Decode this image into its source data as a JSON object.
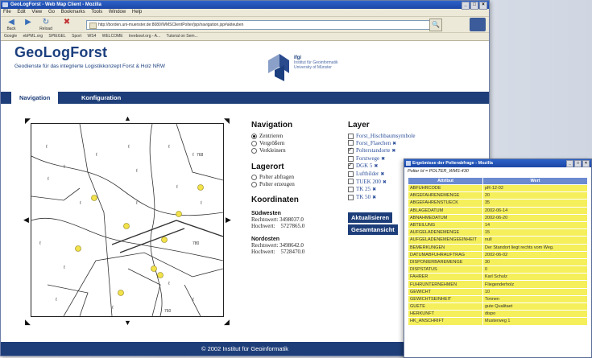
{
  "browser": {
    "title": "GeoLogForst - Web Map Client - Mozilla",
    "menu": [
      "File",
      "Edit",
      "View",
      "Go",
      "Bookmarks",
      "Tools",
      "Window",
      "Help"
    ],
    "back_label": "Back",
    "forward_label": "",
    "reload_label": "Reload",
    "url": "http://borden.uni-muenster.de:8080/WMSClientPolter/jsp/navigation.jsp#akteuben",
    "bookmarks": [
      "Google",
      "ebPML.org",
      "SPIEGEL",
      "Sport",
      "WS4",
      "WELCOME",
      "treebowl.org - A...",
      "Tutorial on Sem..."
    ]
  },
  "header": {
    "title": "GeoLogForst",
    "subtitle": "Geodienste für das integrierte Logistikkonzept Forst & Holz NRW",
    "inst_short": "ifgi",
    "inst_line1": "Institut für Geoinformatik",
    "inst_line2": "University of Münster"
  },
  "tabs": [
    {
      "label": "Navigation",
      "active": true
    },
    {
      "label": "Konfiguration",
      "active": false
    }
  ],
  "navigation": {
    "heading": "Navigation",
    "options": [
      {
        "label": "Zentrieren",
        "selected": true
      },
      {
        "label": "Vergrößern",
        "selected": false
      },
      {
        "label": "Verkleinern",
        "selected": false
      }
    ]
  },
  "lagerort": {
    "heading": "Lagerort",
    "options": [
      {
        "label": "Polter abfragen",
        "selected": false
      },
      {
        "label": "Polter erzeugen",
        "selected": false
      }
    ]
  },
  "koordinaten": {
    "heading": "Koordinaten",
    "sw_label": "Südwesten",
    "sw_rechts": "Rechtswert: 3498037.0",
    "sw_hoch": "Hochwert:    5727865.0",
    "ne_label": "Nordosten",
    "ne_rechts": "Rechtswert: 3498642.0",
    "ne_hoch": "Hochwert:    5728470.0"
  },
  "layer": {
    "heading": "Layer",
    "items": [
      {
        "label": "Forst_Hischbaumsymbole",
        "checked": false,
        "x": false
      },
      {
        "label": "Forst_Flaechen",
        "checked": false,
        "x": true
      },
      {
        "label": "Polterstandorte",
        "checked": true,
        "x": true
      },
      {
        "label": "Forstwege",
        "checked": false,
        "x": true
      },
      {
        "label": "DGK 5",
        "checked": true,
        "x": true
      },
      {
        "label": "Luftbilder",
        "checked": false,
        "x": true
      },
      {
        "label": "TUEK 200",
        "checked": false,
        "x": true
      },
      {
        "label": "TK 25",
        "checked": false,
        "x": true
      },
      {
        "label": "TK 50",
        "checked": false,
        "x": true
      }
    ],
    "refresh_label": "Aktualisieren",
    "overview_label": "Gesamtansicht"
  },
  "map": {
    "labels": [
      "768",
      "780",
      "760"
    ],
    "colors": {
      "polter": "#f2e24a",
      "line": "#333333"
    }
  },
  "footer": "© 2002 Institut für Geoinformatik",
  "popup": {
    "title": "Ergebnisse der Polterabfrage - Mozilla",
    "polter_id": "Polter Id = POLTER_WMS-430",
    "col_attr": "Attribut",
    "col_val": "Wert",
    "rows": [
      [
        "ABFUHRCODE",
        "pR-12-02"
      ],
      [
        "ABGEFAHRENEMENGE",
        "20"
      ],
      [
        "ABGEFAHRENSTUECK",
        "35"
      ],
      [
        "ABLAGEDATUM",
        "2002-06-14"
      ],
      [
        "ABNAHMEDATUM",
        "2002-06-20"
      ],
      [
        "ABTEILUNG",
        "14"
      ],
      [
        "AUFGELADENEMENGE",
        "15"
      ],
      [
        "AUFGELADENEMENGEEINHEIT",
        "null"
      ],
      [
        "BEMERKUNGEN",
        "Der Standort liegt rechts vom Weg."
      ],
      [
        "DATUMABFUHRAUFTRAG",
        "2002-06-02"
      ],
      [
        "DISPONIERBAREMENGE",
        "30"
      ],
      [
        "DISPSTATUS",
        "0"
      ],
      [
        "FAHRER",
        "Karl Schulz"
      ],
      [
        "FUHRUNTERNEHMEN",
        "Fliegenderholz"
      ],
      [
        "GEWICHT",
        "10"
      ],
      [
        "GEWICHTSEINHEIT",
        "Tonnen"
      ],
      [
        "GUETE",
        "gute Qualitaet"
      ],
      [
        "HERKUNFT",
        "dispo"
      ],
      [
        "HK_ANSCHRIFT",
        "Musterweg 1"
      ]
    ]
  }
}
